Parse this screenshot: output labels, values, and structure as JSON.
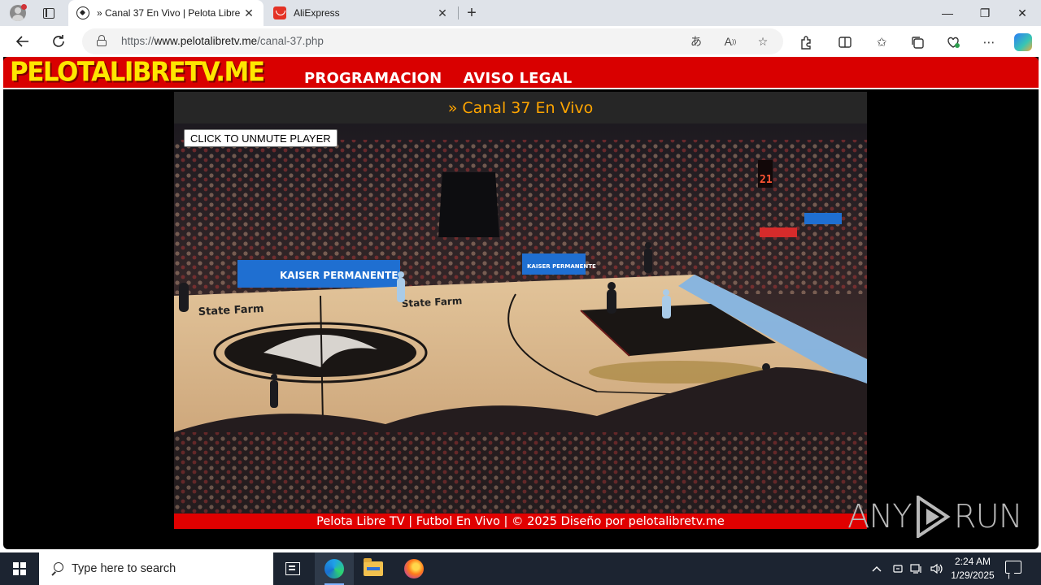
{
  "browser": {
    "tabs": [
      {
        "title": "» Canal 37 En Vivo | Pelota Libre TV",
        "favicon": "soccer-ball-icon",
        "active": true,
        "close": "✕"
      },
      {
        "title": "AliExpress",
        "favicon": "aliexpress-icon",
        "active": false,
        "close": "✕"
      }
    ],
    "new_tab": "+",
    "window_controls": {
      "minimize": "—",
      "restore": "❐",
      "close": "✕"
    },
    "url": {
      "prefix": "https://",
      "host": "www.pelotalibretv.me",
      "path": "/canal-37.php"
    },
    "omnibox_icons": [
      "translate-icon",
      "read-aloud-icon",
      "favorite-star-icon"
    ],
    "toolbar_icons": [
      "extensions-icon",
      "split-screen-icon",
      "favorites-icon",
      "collections-icon",
      "browser-essentials-icon",
      "more-icon",
      "copilot-icon"
    ]
  },
  "site": {
    "logo": "PELOTALIBRETV.ME",
    "nav": [
      "PROGRAMACION",
      "AVISO LEGAL"
    ],
    "channel_title": "» Canal 37 En Vivo",
    "player": {
      "unmute_label": "CLICK TO UNMUTE PLAYER"
    },
    "footer": "Pelota Libre TV | Futbol En Vivo | © 2025 Diseño por pelotalibretv.me",
    "colors": {
      "header_red": "#d90000",
      "logo_yellow": "#ffe600",
      "title_orange": "#ffa500",
      "footer_red": "#e00000"
    }
  },
  "watermark": "ANY RUN",
  "taskbar": {
    "search_placeholder": "Type here to search",
    "apps": [
      "task-view-icon",
      "edge-icon",
      "file-explorer-icon",
      "firefox-icon"
    ],
    "tray_icons": [
      "chevron-up-icon",
      "network-icon",
      "security-icon",
      "volume-icon"
    ],
    "time": "2:24 AM",
    "date": "1/29/2025"
  }
}
